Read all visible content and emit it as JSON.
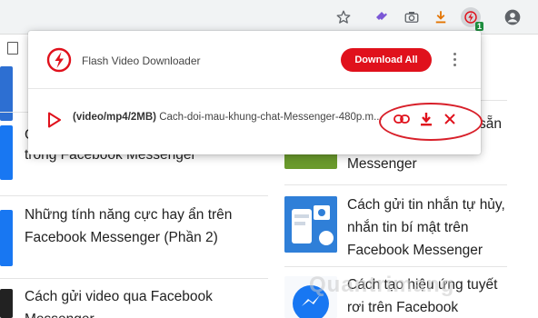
{
  "toolbar": {
    "icons": [
      "star-icon",
      "extension-puzzle-icon",
      "camera-icon",
      "download-arrow-icon",
      "flash-video-downloader-icon",
      "account-icon"
    ],
    "extension_badge": "1"
  },
  "popup": {
    "title": "Flash Video Downloader",
    "download_all_label": "Download All",
    "video": {
      "format": "(video/mp4/2MB)",
      "filename": "Cach-doi-mau-khung-chat-Messenger-480p.m..."
    }
  },
  "background_page": {
    "left_articles": [
      {
        "title_line1": "",
        "title_line2": "trong Facebook Messenger"
      },
      {
        "title_line1": "Những tính năng cực hay ẩn trên",
        "title_line2": "Facebook Messenger (Phần 2)"
      },
      {
        "title_line1": "Cách gửi video qua Facebook",
        "title_line2": "Messenger"
      }
    ],
    "right_articles": [
      {
        "line1": "sẵn",
        "line2": "Messenger"
      },
      {
        "line1": "Cách gửi tin nhắn tự hủy,",
        "line2": "nhắn tin bí mật trên",
        "line3": "Facebook Messenger"
      },
      {
        "line1": "Cách tạo hiệu ứng tuyết",
        "line2": "rơi trên Facebook"
      }
    ],
    "left_edge_fragment": "C",
    "watermark": "Quantrimang"
  },
  "colors": {
    "accent_red": "#e0111c",
    "annotation_red": "#d8202a",
    "messenger_blue": "#1877f2"
  }
}
